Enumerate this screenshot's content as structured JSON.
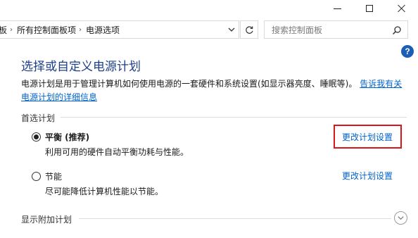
{
  "breadcrumb": {
    "items": [
      "板",
      "所有控制面板项",
      "电源选项"
    ]
  },
  "search": {
    "placeholder": "搜索控制面板"
  },
  "main": {
    "title": "选择或自定义电源计划",
    "description": "电源计划是用于管理计算机如何使用电源的一套硬件和系统设置(如显示器亮度、睡眠等)。",
    "description_link": "告诉我有关电源计划的详细信息",
    "preferred_label": "首选计划",
    "plans": [
      {
        "name": "平衡 (推荐)",
        "description": "利用可用的硬件自动平衡功耗与性能。",
        "change_link": "更改计划设置",
        "selected": true
      },
      {
        "name": "节能",
        "description": "尽可能降低计算机性能以节能。",
        "change_link": "更改计划设置",
        "selected": false
      }
    ],
    "more_plans_label": "显示附加计划"
  },
  "colors": {
    "title_blue": "#1e3f8a",
    "link_blue": "#0063cc",
    "highlight_red": "#d9161c",
    "help_blue": "#1a5fb4"
  },
  "icons": {
    "help": "?",
    "window_controls": [
      "minimize-icon",
      "maximize-icon",
      "close-icon"
    ],
    "addressbar": [
      "chevron-right-icon",
      "chevron-down-icon",
      "refresh-icon",
      "search-icon",
      "expand-chevron-icon"
    ]
  }
}
